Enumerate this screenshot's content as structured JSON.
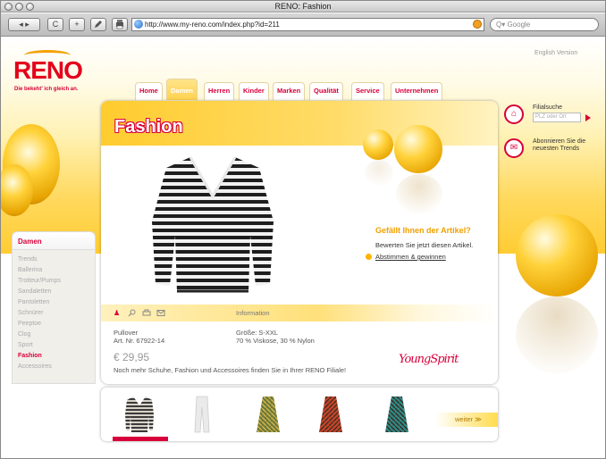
{
  "window": {
    "title": "RENO: Fashion"
  },
  "toolbar": {
    "back_label": "◂ ▸",
    "reload_label": "C",
    "add_label": "+",
    "url": "http://www.my-reno.com/index.php?id=211",
    "search_placeholder": "Q▾ Google"
  },
  "header": {
    "logo_text": "RENO",
    "tagline": "Die bekeht' ich gleich an.",
    "english_link": "English Version"
  },
  "nav": {
    "tabs": [
      {
        "label": "Home"
      },
      {
        "label": "Damen"
      },
      {
        "label": "Herren"
      },
      {
        "label": "Kinder"
      },
      {
        "label": "Marken"
      },
      {
        "label": "Qualität"
      },
      {
        "label": "Service"
      },
      {
        "label": "Unternehmen"
      }
    ],
    "active": "Damen"
  },
  "sidebar": {
    "heading": "Damen",
    "items": [
      "Trends",
      "Ballerina",
      "Trotteur/Pumps",
      "Sandaletten",
      "Pantoletten",
      "Schnürer",
      "Peeptoe",
      "Clog",
      "Sport",
      "Fashion",
      "Accessoires"
    ],
    "active": "Fashion"
  },
  "main": {
    "title": "Fashion",
    "rating_question": "Gefällt Ihnen der Artikel?",
    "rating_text": "Bewerten Sie jetzt diesen Artikel.",
    "rating_link": "Abstimmen & gewinnen",
    "info_label": "Information",
    "product_name": "Pullover",
    "article_no": "Art. Nr. 67922-14",
    "size": "Größe: S-XXL",
    "material": "70 % Viskose, 30 % Nylon",
    "price": "€ 29,95",
    "note": "Noch mehr Schuhe, Fashion und Accessoires finden Sie in Ihrer RENO Filiale!",
    "brand": "YoungSpirit"
  },
  "right": {
    "filial_label": "Filialsuche",
    "filial_placeholder": "PLZ oder Ort",
    "newsletter_text": "Abonnieren Sie die neuesten Trends"
  },
  "thumbs": {
    "more_label": "weiter ≫"
  },
  "colors": {
    "brand_red": "#d8003a",
    "yellow": "#ffcc33"
  }
}
